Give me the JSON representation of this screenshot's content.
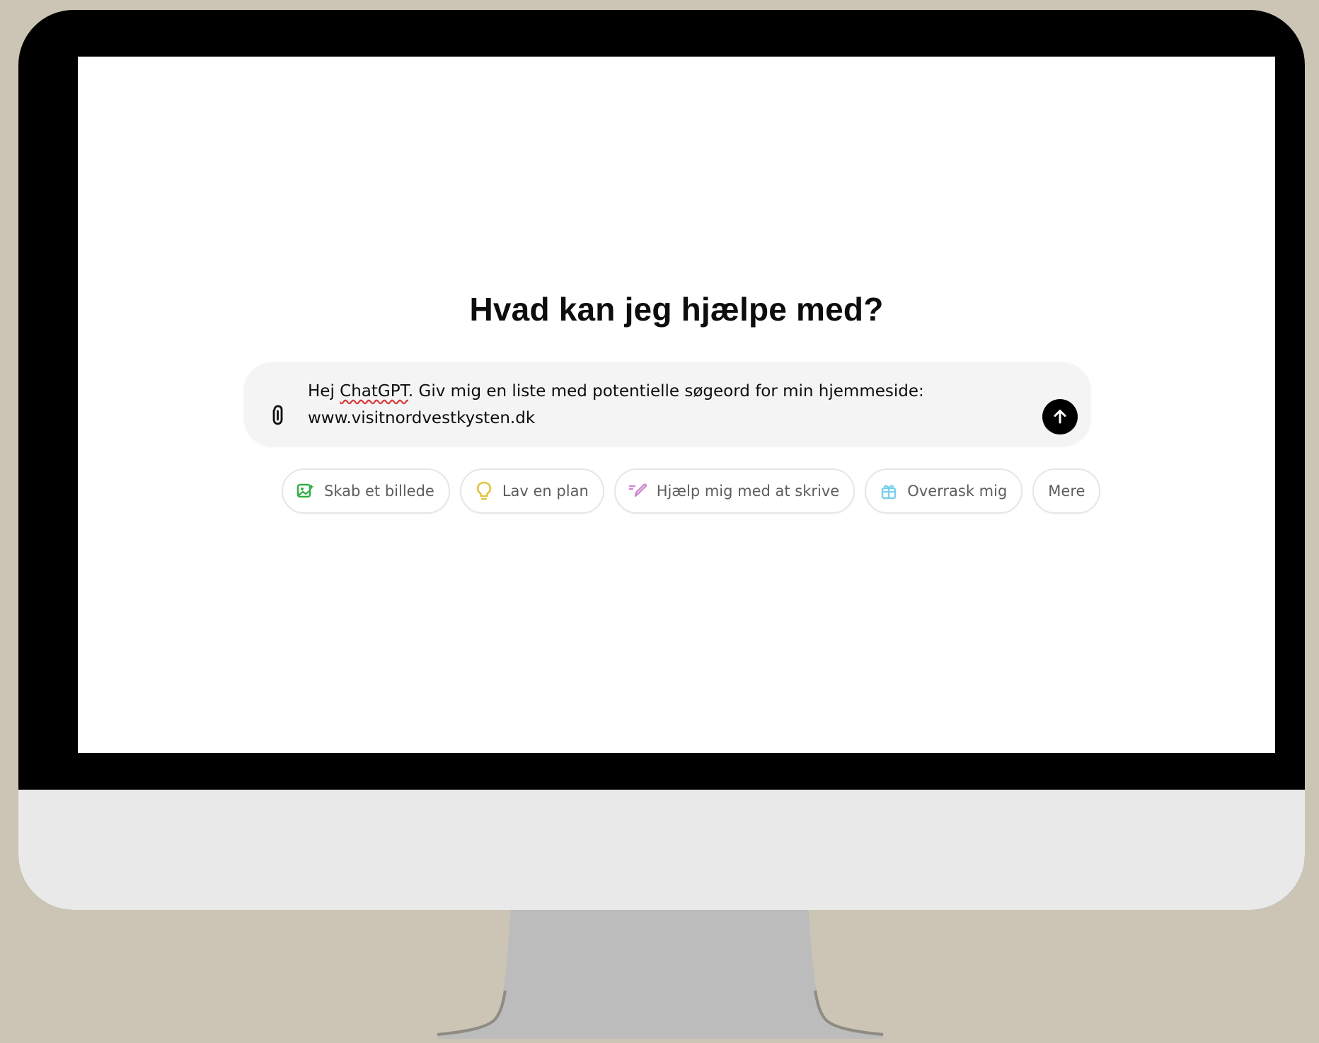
{
  "page": {
    "heading": "Hvad kan jeg hjælpe med?"
  },
  "composer": {
    "line1_prefix": "Hej ",
    "line1_spell": "ChatGPT",
    "line1_suffix": ". Giv mig en liste med potentielle søgeord for min hjemmeside:",
    "line2": "www.visitnordvestkysten.dk",
    "attach_icon": "paperclip-icon",
    "send_icon": "arrow-up-icon"
  },
  "chips": [
    {
      "label": "Skab et billede",
      "icon": "image-icon",
      "color": "#35ae47"
    },
    {
      "label": "Lav en plan",
      "icon": "lightbulb-icon",
      "color": "#e2c541"
    },
    {
      "label": "Hjælp mig med at skrive",
      "icon": "pen-icon",
      "color": "#cb8bd0"
    },
    {
      "label": "Overrask mig",
      "icon": "gift-icon",
      "color": "#76d0eb"
    },
    {
      "label": "Mere",
      "icon": "",
      "color": ""
    }
  ],
  "colors": {
    "background": "#ccc5b6",
    "bezel": "#000000",
    "chin": "#e9e9e9",
    "stand": "#bcbcbc",
    "composer_bg": "#f4f4f4"
  }
}
